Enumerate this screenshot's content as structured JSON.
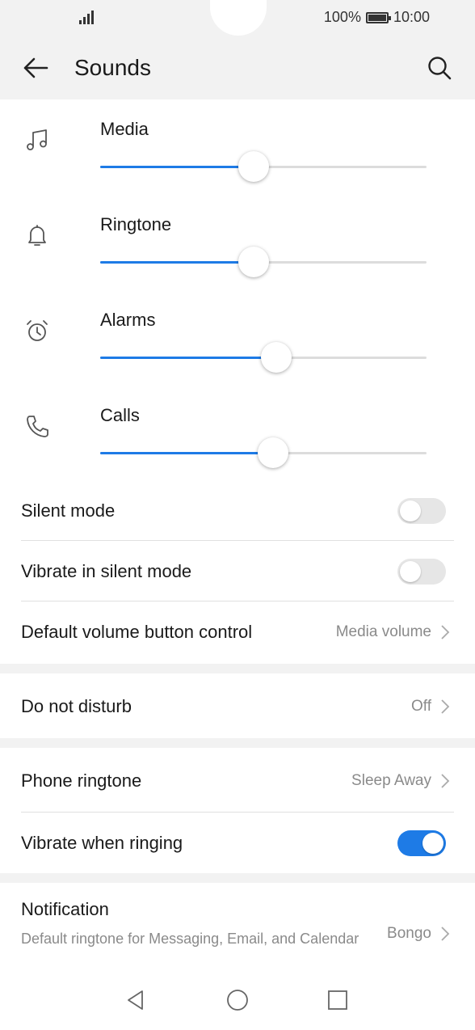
{
  "status": {
    "battery": "100%",
    "time": "10:00"
  },
  "appbar": {
    "title": "Sounds"
  },
  "volumes": [
    {
      "label": "Media",
      "icon": "music-note-icon",
      "level": 0.47
    },
    {
      "label": "Ringtone",
      "icon": "bell-icon",
      "level": 0.47
    },
    {
      "label": "Alarms",
      "icon": "alarm-clock-icon",
      "level": 0.54
    },
    {
      "label": "Calls",
      "icon": "phone-icon",
      "level": 0.53
    }
  ],
  "rows": {
    "silent_mode": {
      "label": "Silent mode",
      "on": false
    },
    "vibrate_silent": {
      "label": "Vibrate in silent mode",
      "on": false
    },
    "default_volume": {
      "label": "Default volume button control",
      "value": "Media volume"
    },
    "dnd": {
      "label": "Do not disturb",
      "value": "Off"
    },
    "phone_ringtone": {
      "label": "Phone ringtone",
      "value": "Sleep Away"
    },
    "vibrate_ringing": {
      "label": "Vibrate when ringing",
      "on": true
    },
    "notification": {
      "label": "Notification",
      "sub": "Default ringtone for Messaging, Email, and Calendar",
      "value": "Bongo"
    }
  },
  "colors": {
    "accent": "#1e7be6",
    "background": "#f2f2f2"
  }
}
